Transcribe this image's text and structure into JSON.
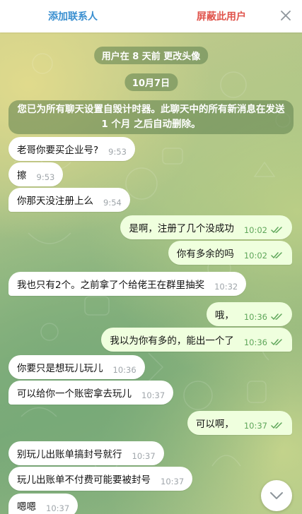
{
  "topbar": {
    "add_contact": "添加联系人",
    "block_user": "屏蔽此用户"
  },
  "system": {
    "avatar_changed": "用户在 8 天前 更改头像",
    "date": "10月7日",
    "timer_notice": "您已为所有聊天设置自毁计时器。此聊天中的所有新消息在发送 1 个月 之后自动删除。"
  },
  "messages": [
    {
      "dir": "in",
      "text": "老哥你要买企业号?",
      "time": "9:53"
    },
    {
      "dir": "in",
      "text": "擦",
      "time": "9:53"
    },
    {
      "dir": "in",
      "text": "你那天没注册上么",
      "time": "9:54"
    },
    {
      "dir": "out",
      "text": "是啊，注册了几个没成功",
      "time": "10:02"
    },
    {
      "dir": "out",
      "text": "你有多余的吗",
      "time": "10:02"
    },
    {
      "dir": "in",
      "text": "我也只有2个。之前拿了个给佬王在群里抽奖",
      "time": "10:32"
    },
    {
      "dir": "out",
      "text": "哦，",
      "time": "10:36"
    },
    {
      "dir": "out",
      "text": "我以为你有多的，能出一个了",
      "time": "10:36"
    },
    {
      "dir": "in",
      "text": "你要只是想玩儿玩儿",
      "time": "10:36"
    },
    {
      "dir": "in",
      "text": "可以给你一个账密拿去玩儿",
      "time": "10:37"
    },
    {
      "dir": "out",
      "text": "可以啊，",
      "time": "10:37"
    },
    {
      "dir": "in",
      "text": "别玩儿出账单搞封号就行",
      "time": "10:37"
    },
    {
      "dir": "in",
      "text": "玩儿出账单不付费可能要被封号",
      "time": "10:37"
    },
    {
      "dir": "in",
      "text": "嗯嗯",
      "time": "10:37"
    }
  ],
  "icons": {
    "close": "close-icon",
    "read_check": "double-check-icon",
    "scroll_down": "chevron-down-icon"
  },
  "colors": {
    "add_contact": "#3a8fd0",
    "block_user": "#e0544c",
    "incoming_bubble": "#ffffff",
    "outgoing_bubble": "#efffde",
    "outgoing_time": "#5fa65a"
  }
}
